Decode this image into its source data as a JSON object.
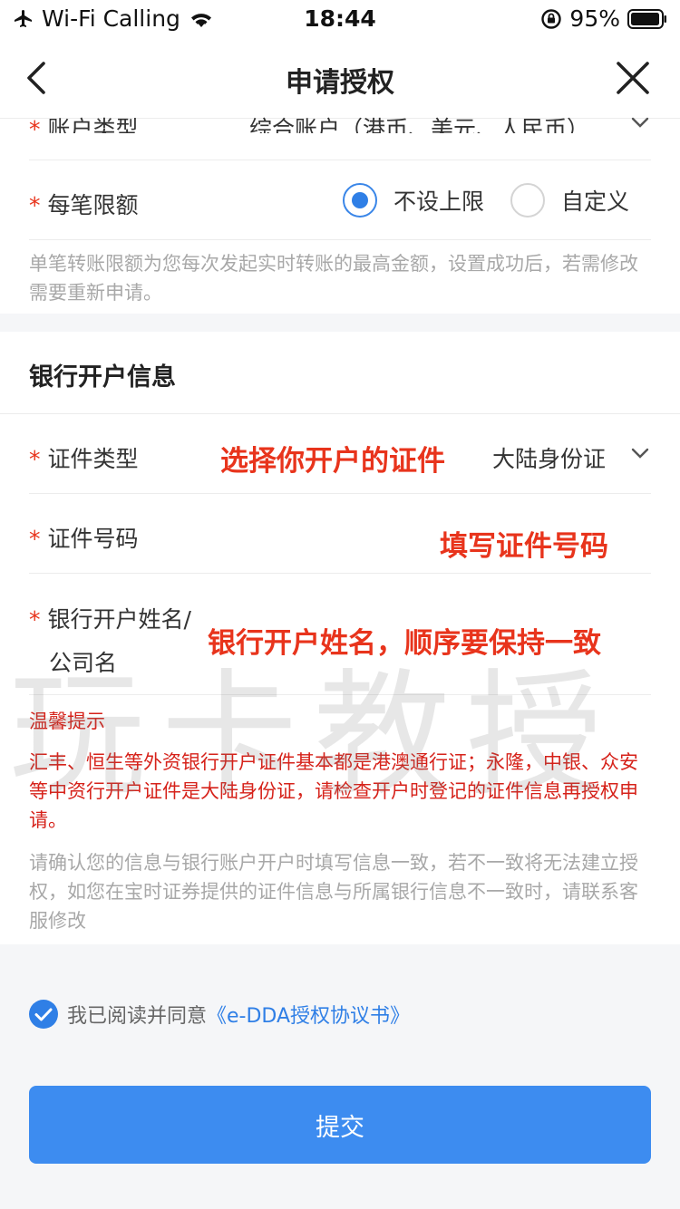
{
  "status_bar": {
    "carrier": "Wi-Fi Calling",
    "time": "18:44",
    "battery": "95%",
    "icons": [
      "airplane-icon",
      "wifi-icon",
      "orientation-lock-icon",
      "battery-icon"
    ]
  },
  "nav": {
    "title": "申请授权",
    "back_icon": "chevron-left-icon",
    "close_icon": "close-icon"
  },
  "form": {
    "account_type": {
      "label": "账户类型",
      "value": "综合账户（港币、美元、人民币）"
    },
    "limit": {
      "label": "每笔限额",
      "options": [
        "不设上限",
        "自定义"
      ],
      "selected": "不设上限",
      "hint": "单笔转账限额为您每次发起实时转账的最高金额，设置成功后，若需修改需要重新申请。"
    },
    "bank_section": {
      "title": "银行开户信息",
      "id_type": {
        "label": "证件类型",
        "value": "大陆身份证",
        "annotation": "选择你开户的证件"
      },
      "id_number": {
        "label": "证件号码",
        "placeholder": "",
        "annotation": "填写证件号码"
      },
      "account_name": {
        "label_line1": "银行开户姓名/",
        "label_line2": "公司名",
        "annotation": "银行开户姓名，顺序要保持一致"
      }
    },
    "tip": {
      "title": "温馨提示",
      "body": "汇丰、恒生等外资银行开户证件基本都是港澳通行证；永隆，中银、众安等中资行开户证件是大陆身份证，请检查开户时登记的证件信息再授权申请。"
    },
    "notice": "请确认您的信息与银行账户开户时填写信息一致，若不一致将无法建立授权，如您在宝时证券提供的证件信息与所属银行信息不一致时，请联系客服修改"
  },
  "agreement": {
    "checked": true,
    "prefix": "我已阅读并同意",
    "link": "《e-DDA授权协议书》"
  },
  "submit_label": "提交",
  "watermark": "玩卡教授",
  "colors": {
    "accent": "#2f7fe6",
    "required": "#e8341c",
    "annotation": "#e8341c",
    "warning": "#d6221a",
    "button": "#3d8cf0"
  }
}
